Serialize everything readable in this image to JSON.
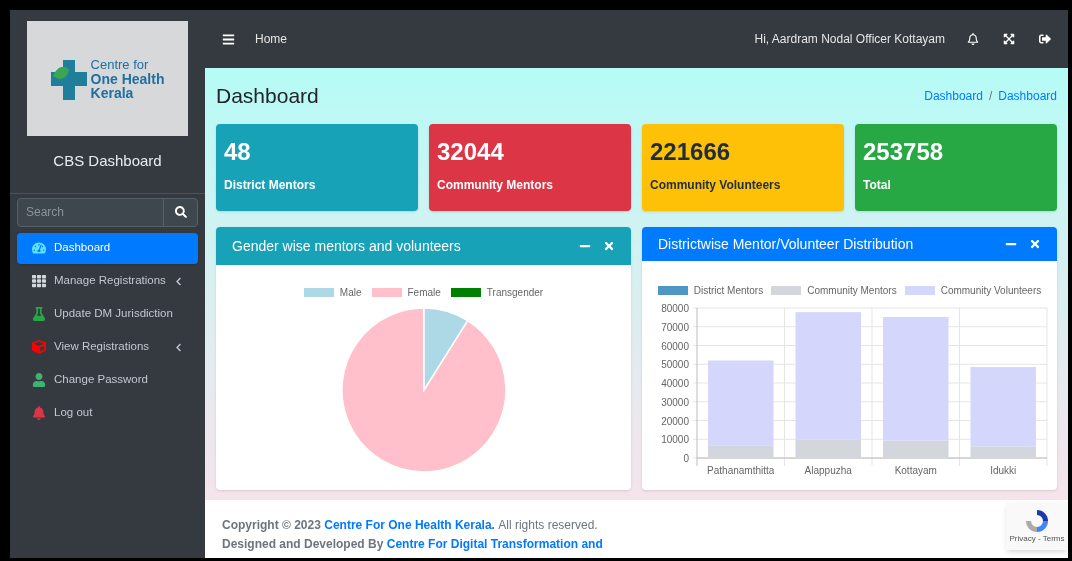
{
  "sidebar": {
    "logo": {
      "line1": "Centre for",
      "line2": "One Health",
      "line3": "Kerala"
    },
    "title": "CBS Dashboard",
    "search": {
      "placeholder": "Search"
    },
    "items": [
      {
        "label": "Dashboard",
        "kind": "dashboard",
        "selected": true,
        "has_submenu": false
      },
      {
        "label": "Manage Registrations",
        "kind": "grid",
        "selected": false,
        "has_submenu": true
      },
      {
        "label": "Update DM Jurisdiction",
        "kind": "flask",
        "selected": false,
        "has_submenu": false
      },
      {
        "label": "View Registrations",
        "kind": "cube",
        "selected": false,
        "has_submenu": true
      },
      {
        "label": "Change Password",
        "kind": "user",
        "selected": false,
        "has_submenu": false
      },
      {
        "label": "Log out",
        "kind": "bell",
        "selected": false,
        "has_submenu": false
      }
    ]
  },
  "topbar": {
    "home": "Home",
    "greeting": "Hi, Aardram Nodal Officer Kottayam"
  },
  "page_title": "Dashboard",
  "breadcrumb": [
    "Dashboard",
    "Dashboard"
  ],
  "breadcrumb_separator": "/",
  "stats": [
    {
      "value": "48",
      "label": "District Mentors",
      "color": "#17a2b8"
    },
    {
      "value": "32044",
      "label": "Community Mentors",
      "color": "#dc3545"
    },
    {
      "value": "221666",
      "label": "Community Volunteers",
      "color": "#ffc107"
    },
    {
      "value": "253758",
      "label": "Total",
      "color": "#28a745"
    }
  ],
  "gender_panel": {
    "title": "Gender wise mentors and volunteers",
    "legend": [
      {
        "label": "Male",
        "color": "#add8e6"
      },
      {
        "label": "Female",
        "color": "#ffc0cb"
      },
      {
        "label": "Transgender",
        "color": "#008000"
      }
    ]
  },
  "district_panel": {
    "title": "Districtwise Mentor/Volunteer Distribution",
    "chart_data": {
      "type": "bar",
      "stacked": true,
      "grid": true,
      "categories": [
        "Pathanamthitta",
        "Alappuzha",
        "Kottayam",
        "Idukki"
      ],
      "ylim": [
        0,
        80000
      ],
      "yticks": [
        0,
        10000,
        20000,
        30000,
        40000,
        50000,
        60000,
        70000,
        80000
      ],
      "series": [
        {
          "name": "District Mentors",
          "color": "#4e96c4",
          "values": [
            0,
            0,
            0,
            0
          ]
        },
        {
          "name": "Community Mentors",
          "color": "#d3d6dc",
          "values": [
            6500,
            9800,
            9300,
            6200
          ]
        },
        {
          "name": "Community Volunteers",
          "color": "#d4d6fb",
          "values": [
            45500,
            68000,
            65900,
            42300
          ]
        }
      ]
    }
  },
  "footer": {
    "copyright_prefix": "Copyright © 2023",
    "copyright_link": "Centre For One Health Kerala.",
    "copyright_suffix": "All rights reserved.",
    "designed_prefix": "Designed and Developed By",
    "designed_link": "Centre For Digital Transformation and"
  },
  "recaptcha": {
    "text": "Privacy - Terms"
  }
}
